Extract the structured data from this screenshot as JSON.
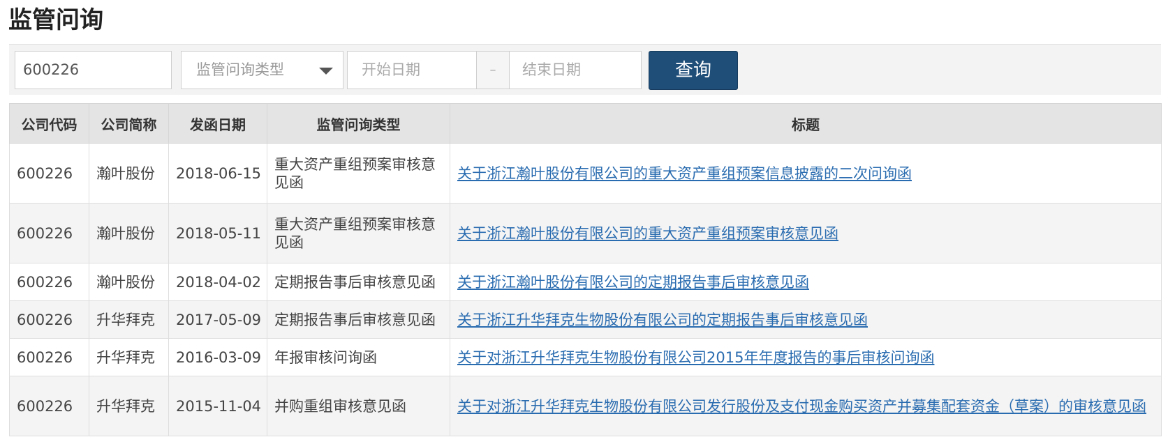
{
  "page": {
    "title": "监管问询"
  },
  "filters": {
    "code_value": "600226",
    "type_placeholder": "监管问询类型",
    "start_placeholder": "开始日期",
    "separator": "–",
    "end_placeholder": "结束日期",
    "query_label": "查询"
  },
  "table": {
    "headers": [
      "公司代码",
      "公司简称",
      "发函日期",
      "监管问询类型",
      "标题"
    ],
    "rows": [
      {
        "code": "600226",
        "name": "瀚叶股份",
        "date": "2018-06-15",
        "type": "重大资产重组预案审核意见函",
        "title": "关于浙江瀚叶股份有限公司的重大资产重组预案信息披露的二次问询函"
      },
      {
        "code": "600226",
        "name": "瀚叶股份",
        "date": "2018-05-11",
        "type": "重大资产重组预案审核意见函",
        "title": "关于浙江瀚叶股份有限公司的重大资产重组预案审核意见函"
      },
      {
        "code": "600226",
        "name": "瀚叶股份",
        "date": "2018-04-02",
        "type": "定期报告事后审核意见函",
        "title": "关于浙江瀚叶股份有限公司的定期报告事后审核意见函"
      },
      {
        "code": "600226",
        "name": "升华拜克",
        "date": "2017-05-09",
        "type": "定期报告事后审核意见函",
        "title": "关于浙江升华拜克生物股份有限公司的定期报告事后审核意见函"
      },
      {
        "code": "600226",
        "name": "升华拜克",
        "date": "2016-03-09",
        "type": "年报审核问询函",
        "title": "关于对浙江升华拜克生物股份有限公司2015年年度报告的事后审核问询函"
      },
      {
        "code": "600226",
        "name": "升华拜克",
        "date": "2015-11-04",
        "type": "并购重组审核意见函",
        "title": "关于对浙江升华拜克生物股份有限公司发行股份及支付现金购买资产并募集配套资金（草案）的审核意见函"
      }
    ]
  },
  "colors": {
    "accent": "#1f4e79",
    "link": "#2a6cb0",
    "header_bg": "#e4e4e4"
  }
}
